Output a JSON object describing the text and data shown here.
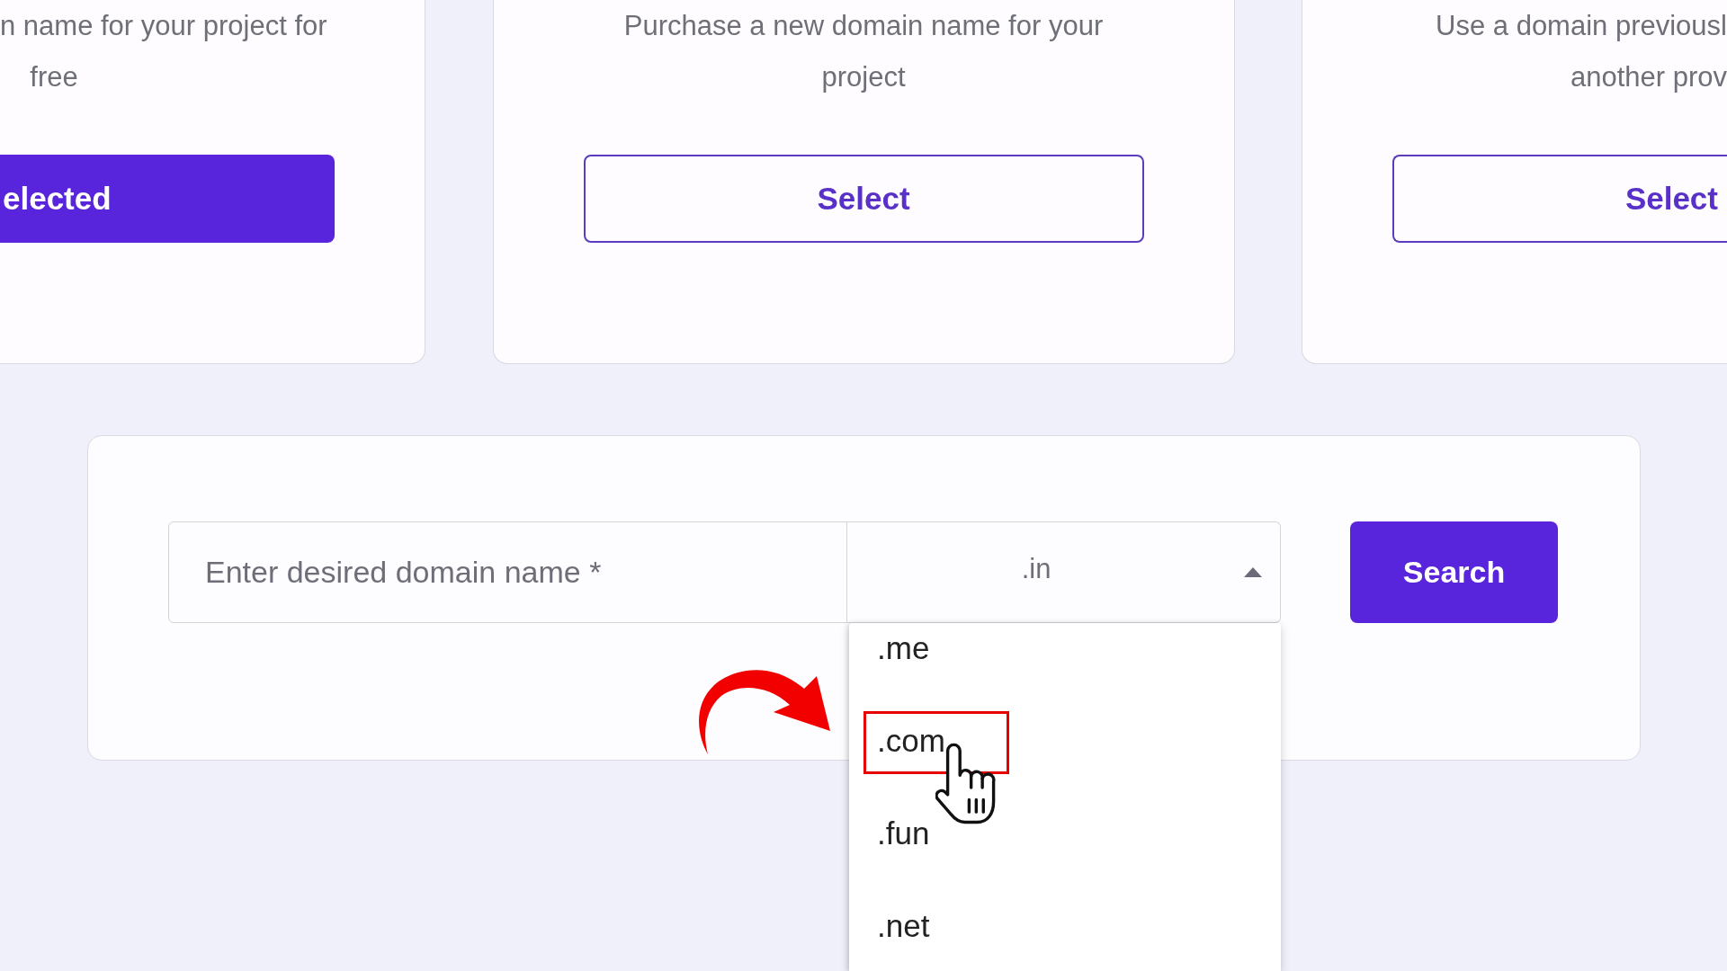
{
  "options": [
    {
      "description_lines": [
        "n name for your project for",
        "free"
      ],
      "button": "elected",
      "selected": true
    },
    {
      "description_lines": [
        "Purchase a new domain name for your",
        "project"
      ],
      "button": "Select",
      "selected": false
    },
    {
      "description_lines": [
        "Use a domain previousl",
        "another prov"
      ],
      "button": "Select",
      "selected": false
    }
  ],
  "search": {
    "domain_field": {
      "placeholder": "Enter desired domain name *"
    },
    "tld_select": {
      "value": ".in",
      "expanded": true
    },
    "tld_options": [
      {
        "label": ".me",
        "highlighted": false
      },
      {
        "label": ".com",
        "highlighted": true
      },
      {
        "label": ".fun",
        "highlighted": false
      },
      {
        "label": ".net",
        "highlighted": false
      }
    ],
    "button": "Search"
  }
}
